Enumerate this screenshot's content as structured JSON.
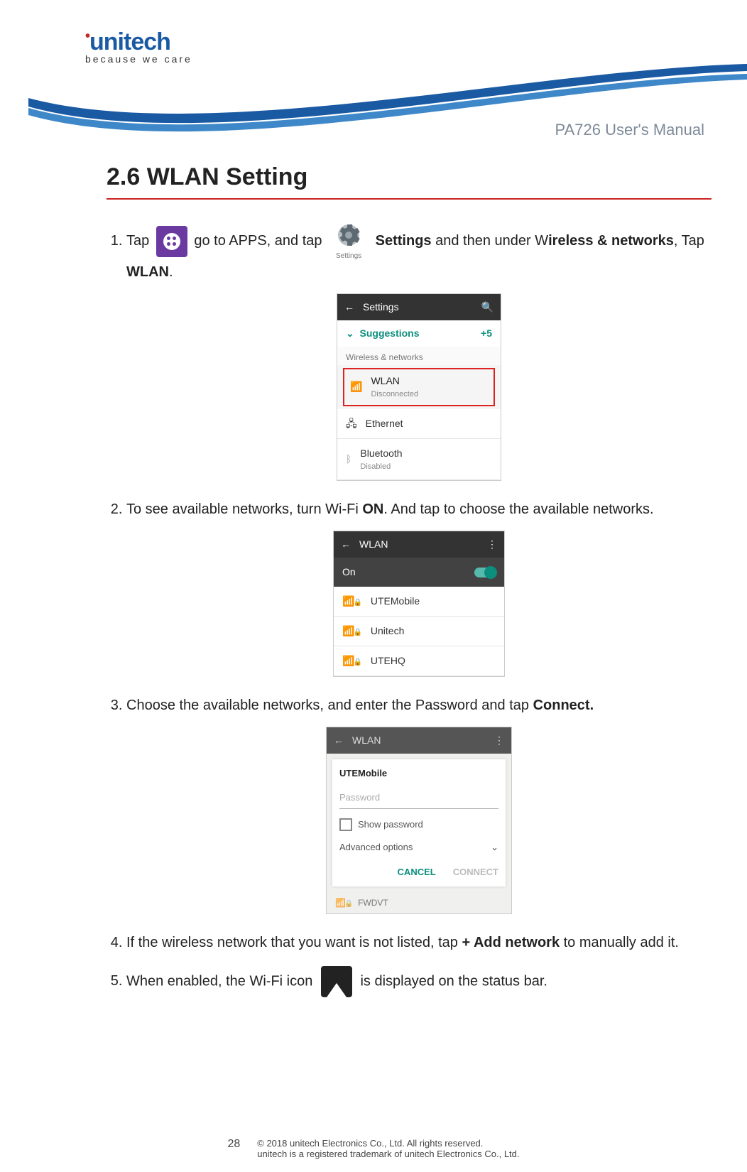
{
  "brand": {
    "name": "unitech",
    "tagline": "because we care"
  },
  "doc_title": "PA726 User's Manual",
  "section_title": "2.6 WLAN Setting",
  "steps": {
    "s1_a": "Tap",
    "s1_b": "go to APPS, and tap",
    "s1_c": "Settings",
    "s1_d": " and then under W",
    "s1_e": "ireless & networks",
    "s1_f": ", Tap ",
    "s1_g": "WLAN",
    "s1_h": ".",
    "s2_a": "To see available networks, turn Wi-Fi ",
    "s2_b": "ON",
    "s2_c": ". And tap to choose the available networks.",
    "s3_a": "Choose the available networks, and enter the Password and tap ",
    "s3_b": "Connect.",
    "s4_a": "If the wireless network that you want is not listed, tap ",
    "s4_b": "+ Add network",
    "s4_c": " to manually add it.",
    "s5_a": "When enabled, the Wi-Fi icon",
    "s5_b": "is displayed on the status bar."
  },
  "gear_label": "Settings",
  "shot1": {
    "title": "Settings",
    "sugg": "Suggestions",
    "sugg_count": "+5",
    "cat": "Wireless & networks",
    "wlan": "WLAN",
    "wlan_sub": "Disconnected",
    "eth": "Ethernet",
    "bt": "Bluetooth",
    "bt_sub": "Disabled"
  },
  "shot2": {
    "title": "WLAN",
    "state": "On",
    "net1": "UTEMobile",
    "net2": "Unitech",
    "net3": "UTEHQ"
  },
  "shot3": {
    "title": "WLAN",
    "dlg_title": "UTEMobile",
    "pw_hint": "Password",
    "show_pw": "Show password",
    "adv": "Advanced options",
    "cancel": "CANCEL",
    "connect": "CONNECT",
    "dimnet": "FWDVT"
  },
  "footer": {
    "page": "28",
    "line1": "© 2018 unitech Electronics Co., Ltd. All rights reserved.",
    "line2": "unitech is a registered trademark of unitech Electronics Co., Ltd."
  }
}
